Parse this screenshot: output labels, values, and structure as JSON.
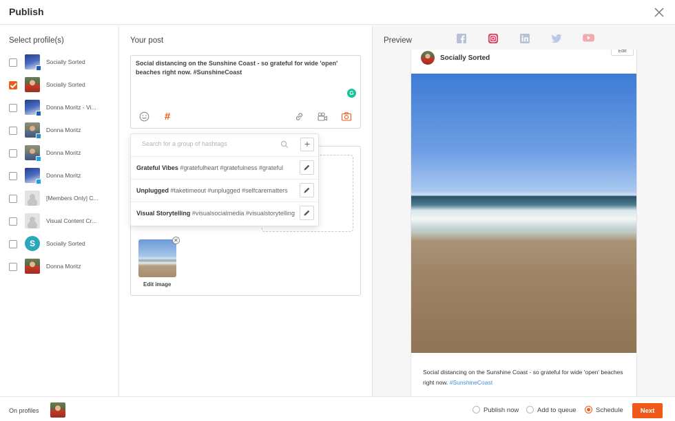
{
  "header": {
    "title": "Publish"
  },
  "profiles": {
    "title": "Select profile(s)",
    "items": [
      {
        "name": "Socially Sorted",
        "checked": false
      },
      {
        "name": "Socially Sorted",
        "checked": true
      },
      {
        "name": "Donna Moritz - Vi...",
        "checked": false
      },
      {
        "name": "Donna Moritz",
        "checked": false
      },
      {
        "name": "Donna Moritz",
        "checked": false
      },
      {
        "name": "Donna Moritz",
        "checked": false
      },
      {
        "name": "[Members Only] C...",
        "checked": false
      },
      {
        "name": "Visual Content Cr...",
        "checked": false
      },
      {
        "name": "Socially Sorted",
        "checked": false
      },
      {
        "name": "Donna Moritz",
        "checked": false
      }
    ]
  },
  "post": {
    "title": "Your post",
    "text": "Social distancing on the Sunshine Coast - so grateful for wide 'open' beaches right now. #SunshineCoast",
    "grammarly_glyph": "G",
    "hashtag_glyph": "#",
    "edit_image_label": "Edit image",
    "remove_glyph": "✕"
  },
  "hashtags": {
    "search_placeholder": "Search for a group of hashtags",
    "add_glyph": "+",
    "groups": [
      {
        "name": "Grateful Vibes",
        "tags": "#gratefulheart #gratefulness #grateful"
      },
      {
        "name": "Unplugged",
        "tags": "#taketimeout #unplugged #selfcarematters"
      },
      {
        "name": "Visual Storytelling",
        "tags": "#visualsocialmedia #visualstorytelling"
      }
    ]
  },
  "preview": {
    "title": "Preview",
    "tabs": [
      "facebook",
      "instagram",
      "linkedin",
      "twitter",
      "youtube"
    ],
    "active_tab": "instagram",
    "profile_name": "Socially Sorted",
    "edit_label": "Edit",
    "caption_text": "Social distancing on the Sunshine Coast - so grateful for wide 'open' beaches right now. ",
    "caption_tag": "#SunshineCoast"
  },
  "footer": {
    "on_profiles": "On profiles",
    "options": [
      "Publish now",
      "Add to queue",
      "Schedule"
    ],
    "selected": "Schedule",
    "next_label": "Next"
  },
  "colors": {
    "accent": "#ef5a19",
    "link": "#3d8ed8",
    "grammarly": "#15c39a"
  }
}
